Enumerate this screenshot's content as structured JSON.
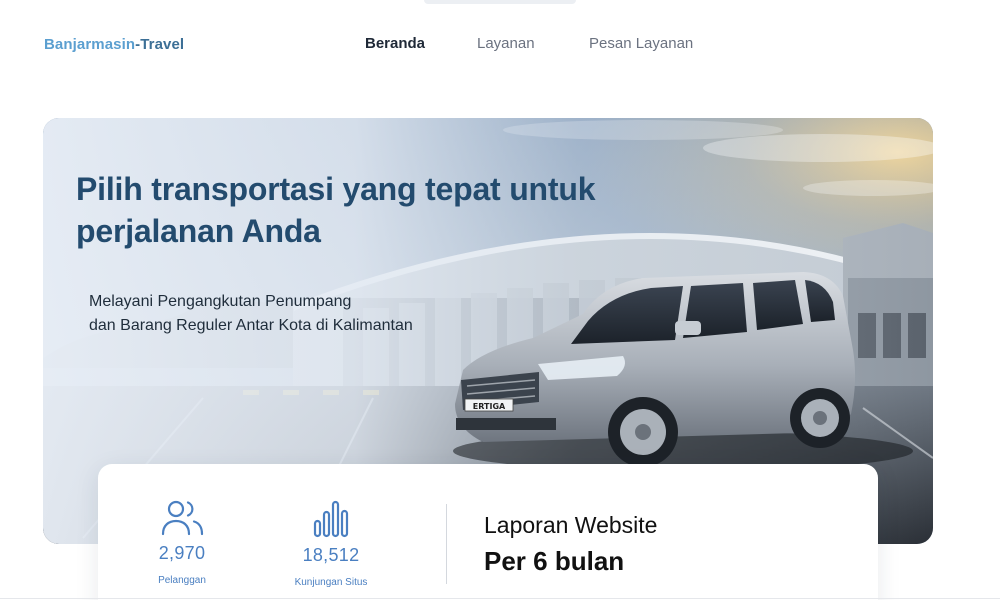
{
  "brand": {
    "part1": "Banjarmasin",
    "part2": "-Travel"
  },
  "nav": {
    "items": [
      {
        "label": "Beranda",
        "active": true
      },
      {
        "label": "Layanan",
        "active": false
      },
      {
        "label": "Pesan Layanan",
        "active": false
      }
    ]
  },
  "hero": {
    "title": "Pilih transportasi yang tepat untuk perjalanan Anda",
    "subtitle_line1": "Melayani Pengangkutan Penumpang",
    "subtitle_line2": "dan Barang Reguler Antar Kota di Kalimantan",
    "car_badge": "ERTIGA"
  },
  "stats": {
    "customers": {
      "value": "2,970",
      "label": "Pelanggan",
      "icon": "users-icon"
    },
    "visits": {
      "value": "18,512",
      "label": "Kunjungan Situs",
      "icon": "bar-chart-icon"
    },
    "report_title": "Laporan Website",
    "report_period": "Per 6 bulan"
  },
  "colors": {
    "brand_light": "#5b9fd0",
    "brand_dark": "#3c6f96",
    "hero_title": "#234b6e",
    "stat_accent": "#4a7fc1"
  }
}
